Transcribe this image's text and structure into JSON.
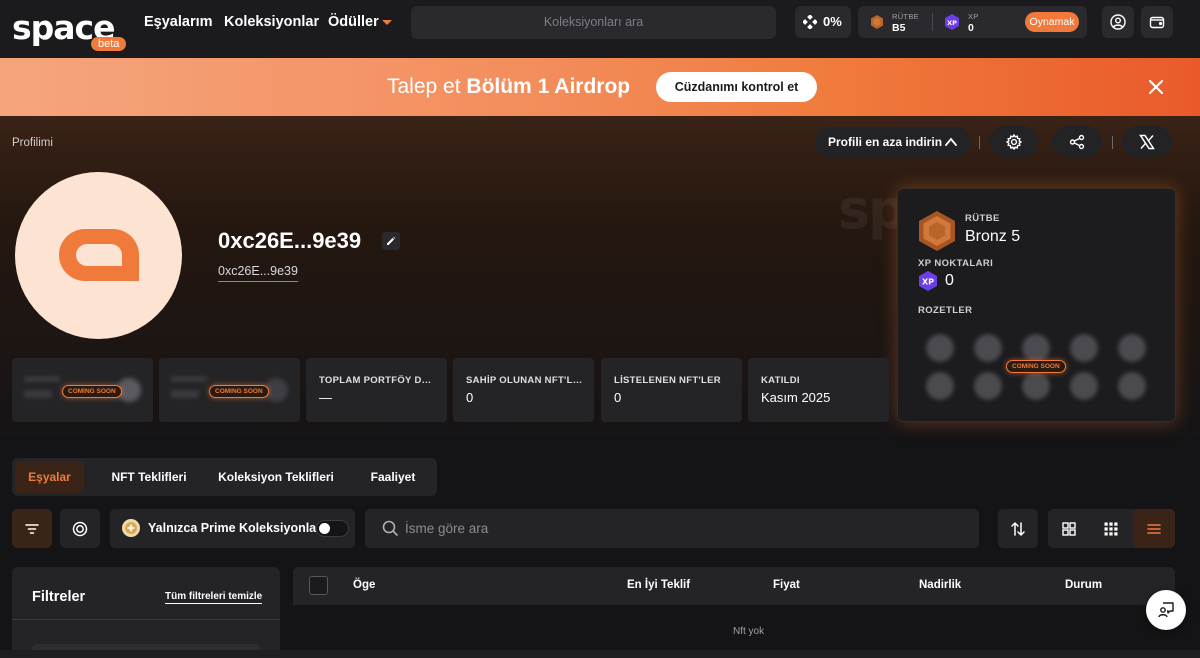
{
  "nav": {
    "logo": "space",
    "beta": "beta",
    "links": [
      "Eşyalarım",
      "Koleksiyonlar",
      "Ödüller"
    ],
    "search_placeholder": "Koleksiyonları ara",
    "percent": "0%",
    "rank_label": "RÜTBE",
    "rank_value": "B5",
    "xp_label": "XP",
    "xp_value": "0",
    "play_label": "Oynamak"
  },
  "banner": {
    "text_pre": "Talep et",
    "text_bold": "Bölüm 1 Airdrop",
    "button": "Cüzdanımı kontrol et"
  },
  "profile": {
    "breadcrumb": "Profilimi",
    "reduce_label": "Profili en aza indirin",
    "address_title": "0xc26E...9e39",
    "address_sub": "0xc26E...9e39",
    "ghost_logo": "space"
  },
  "rank_card": {
    "rank_label": "RÜTBE",
    "rank_value": "Bronz 5",
    "xp_label": "XP NOKTALARI",
    "xp_value": "0",
    "badges_label": "ROZETLER",
    "coming_soon": "COMING SOON"
  },
  "stats": [
    {
      "label": "",
      "value": "",
      "coming_soon": "COMING SOON"
    },
    {
      "label": "",
      "value": "",
      "coming_soon": "COMING SOON"
    },
    {
      "label": "TOPLAM PORTFÖY DEĞERİ",
      "value": "—"
    },
    {
      "label": "SAHİP OLUNAN NFT'LER",
      "value": "0"
    },
    {
      "label": "LİSTELENEN NFT'LER",
      "value": "0"
    },
    {
      "label": "KATILDI",
      "value": "Kasım 2025"
    }
  ],
  "tabs": [
    "Eşyalar",
    "NFT Teklifleri",
    "Koleksiyon Teklifleri",
    "Faaliyet"
  ],
  "toolbar": {
    "prime_label": "Yalnızca Prime Koleksiyonları",
    "search_placeholder": "İsme göre ara"
  },
  "filters": {
    "title": "Filtreler",
    "clear": "Tüm filtreleri temizle"
  },
  "table": {
    "columns": [
      "Öge",
      "En İyi Teklif",
      "Fiyat",
      "Nadirlik",
      "Durum"
    ],
    "empty": "Nft yok"
  },
  "colors": {
    "accent": "#f07a3c",
    "background": "#141416",
    "surface": "#242427"
  }
}
